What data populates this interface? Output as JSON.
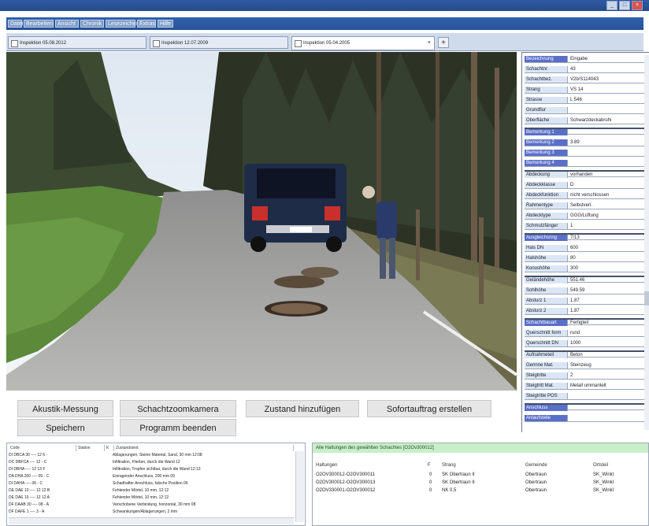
{
  "menu": [
    "Datei",
    "Bearbeiten",
    "Ansicht",
    "Chronik",
    "Lesezeichen",
    "Extras",
    "Hilfe"
  ],
  "tabs": [
    {
      "label": "Inspektion 05.08.2012"
    },
    {
      "label": "Inspektion 12.07.2009"
    },
    {
      "label": "Inspektion 05.04.2005"
    }
  ],
  "properties": [
    {
      "k": "Bezeichnung",
      "v": "Eingabe",
      "hl": true
    },
    {
      "k": "Schachtnr.",
      "v": "43"
    },
    {
      "k": "Schachtbez.",
      "v": "V2b/S114043"
    },
    {
      "k": "Strang",
      "v": "VS 14"
    },
    {
      "k": "Strasse",
      "v": "L 546"
    },
    {
      "k": "Grundflur",
      "v": ""
    },
    {
      "k": "Oberfläche",
      "v": "Schwarzdeckabruhi"
    },
    {
      "k": "Bemerkung 1",
      "v": "",
      "hl": true,
      "sep": true
    },
    {
      "k": "Bemerkung 2",
      "v": "3.89",
      "hl": true
    },
    {
      "k": "Bemerkung 3",
      "v": "",
      "hl": true
    },
    {
      "k": "Bemerkung 4",
      "v": "",
      "hl": true
    },
    {
      "k": "Abdeckung",
      "v": "vorhanden",
      "sep": true
    },
    {
      "k": "Abdeckklasse",
      "v": "D"
    },
    {
      "k": "Abdeckfunktion",
      "v": "nicht verschlossen"
    },
    {
      "k": "Rahmentype",
      "v": "Selbstverl."
    },
    {
      "k": "Abdecktype",
      "v": "GGG/Lüftung"
    },
    {
      "k": "Schmutzfänger",
      "v": "1"
    },
    {
      "k": "Ausgleichsring",
      "v": "7/13",
      "hl": true,
      "sep": true
    },
    {
      "k": "Hals DN",
      "v": "600"
    },
    {
      "k": "Halshöhe",
      "v": "80"
    },
    {
      "k": "Konushöhe",
      "v": "300"
    },
    {
      "k": "Geländehöhe",
      "v": "551.46",
      "sep": true
    },
    {
      "k": "Sohlhöhe",
      "v": "549.59"
    },
    {
      "k": "Absturz 1",
      "v": "1.87"
    },
    {
      "k": "Absturz 2",
      "v": "1.87"
    },
    {
      "k": "Schachtbauart",
      "v": "Fertigteil",
      "hl": true,
      "sep": true
    },
    {
      "k": "Querschnitt form",
      "v": "rund"
    },
    {
      "k": "Querschnitt DN",
      "v": "1000"
    },
    {
      "k": "Aufnahmeteil",
      "v": "Beton",
      "sep": true
    },
    {
      "k": "Gerinne Mat.",
      "v": "Steinzeug"
    },
    {
      "k": "Steigtritte",
      "v": "2"
    },
    {
      "k": "Steigtritt Mat.",
      "v": "Metall ummantelt"
    },
    {
      "k": "Steigtritte POS",
      "v": ""
    },
    {
      "k": "Anschluss",
      "v": "",
      "hl": true,
      "sep": true
    },
    {
      "k": "Anlaufstelle",
      "v": "",
      "hl": true
    }
  ],
  "buttons": {
    "akustik": "Akustik-Messung",
    "schachtzoom": "Schachtzoomkamera",
    "zustand": "Zustand hinzufügen",
    "sofortauftrag": "Sofortauftrag erstellen",
    "speichern": "Speichern",
    "programm_beenden": "Programm beenden"
  },
  "left_list": {
    "headers": [
      "Code",
      "Station",
      "K",
      "Zustandstext"
    ],
    "rows": [
      {
        "code": "DI DBCA  30  ---- 12 6 -",
        "text": "Ablagerungen, Steine Material, Sand, 30 mm 12:08"
      },
      {
        "code": "DC DBFCA  ---- 12 - C",
        "text": "Infiltration, Fließen, durch die Wand 12"
      },
      {
        "code": "DI DBHA  ---- 12 13 F",
        "text": "Infiltration, Tropfen sichtbar, durch die Wand 12:13"
      },
      {
        "code": "DA DHA  200 ---- 09 - C",
        "text": "Einragender Anschluss, 200 mm 09"
      },
      {
        "code": "DI DAHA  ---- 06 - C",
        "text": "Schadhafter Anschluss, falsche Position 06"
      },
      {
        "code": "DE DAE  10 ---- 12 12 B",
        "text": "Fehlender Mörtel, 10 mm, 12:12"
      },
      {
        "code": "DE DAE  10 ---- 12 12 A",
        "text": "Fehlender Mörtel, 10 mm, 12:12"
      },
      {
        "code": "DF DAAB  30 ---- 08 - A",
        "text": "Verschobene Verbindung, horizontal, 30 mm 08"
      },
      {
        "code": "DF DAFE  1 ---- 3 - A",
        "text": "Schwankungen/Ablagerungen, 2 mm"
      }
    ]
  },
  "right_panel": {
    "title": "Alle Haltungen des gewählten Schachtes [O2Ov300012]",
    "headers": [
      "Haltungen",
      "F",
      "Strang",
      "Gemeinde",
      "Ortsteil"
    ],
    "rows": [
      {
        "haltung": "O2OV300012-O2OV300011",
        "f": "0",
        "strang": "SK Obertraun II",
        "gemeinde": "Obertraun",
        "ortsteil": "SK_Winkl"
      },
      {
        "haltung": "O2OV300012-O2OV300013",
        "f": "0",
        "strang": "SK Obertraun II",
        "gemeinde": "Obertraun",
        "ortsteil": "SK_Winkl"
      },
      {
        "haltung": "O2OV330001-O2OV300012",
        "f": "0",
        "strang": "NK 0.5",
        "gemeinde": "Obertraun",
        "ortsteil": "SK_Winkl"
      }
    ]
  },
  "icons": {
    "minimize": "minimize-icon",
    "maximize": "maximize-icon",
    "close": "close-icon",
    "tab_close": "close-icon",
    "add_tab": "plus-icon"
  },
  "colors": {
    "title_bar": "#2a55a0",
    "property_highlight": "#5a6fc8",
    "green_header": "#c8efc8"
  }
}
